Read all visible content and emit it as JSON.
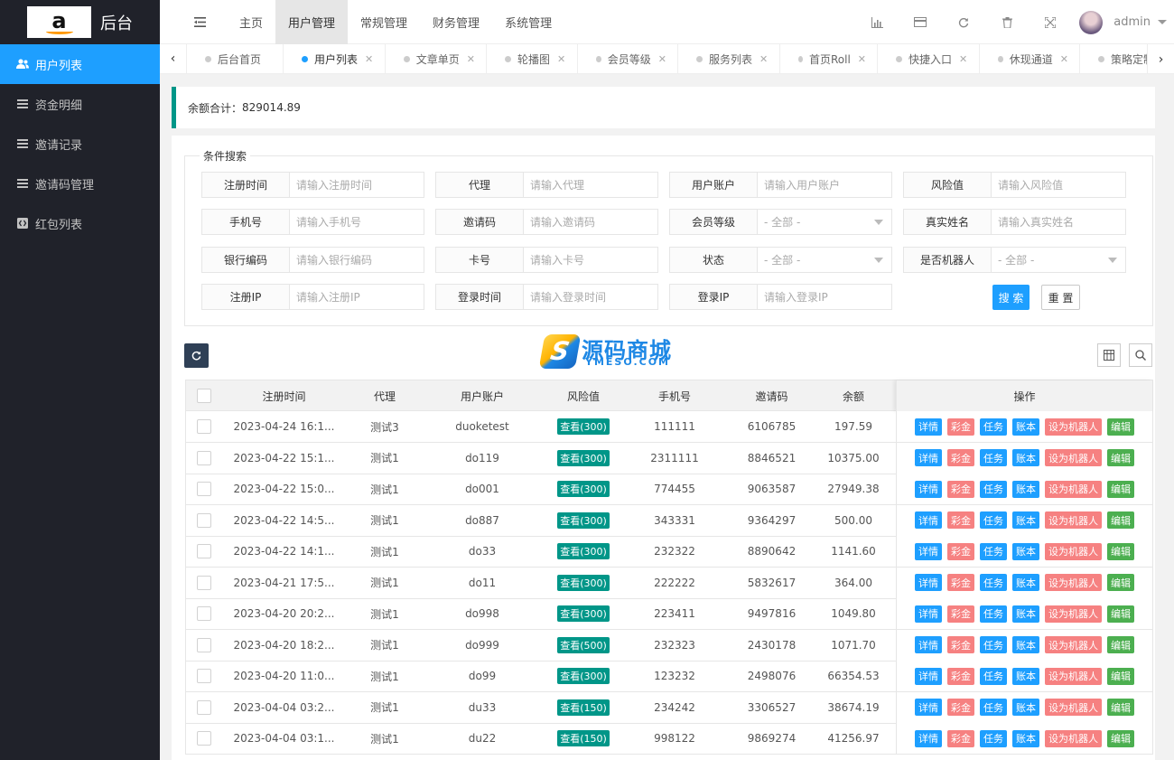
{
  "brand": {
    "logo_letter": "a",
    "title": "后台"
  },
  "sidebar": {
    "items": [
      {
        "label": "用户列表",
        "icon": "users-icon",
        "active": true
      },
      {
        "label": "资金明细",
        "icon": "list-icon",
        "active": false
      },
      {
        "label": "邀请记录",
        "icon": "list-icon",
        "active": false
      },
      {
        "label": "邀请码管理",
        "icon": "list-icon",
        "active": false
      },
      {
        "label": "红包列表",
        "icon": "code-icon",
        "active": false
      }
    ]
  },
  "header": {
    "nav": [
      {
        "label": "主页",
        "active": false
      },
      {
        "label": "用户管理",
        "active": true
      },
      {
        "label": "常规管理",
        "active": false
      },
      {
        "label": "财务管理",
        "active": false
      },
      {
        "label": "系统管理",
        "active": false
      }
    ],
    "user": "admin"
  },
  "tabs": [
    {
      "label": "后台首页",
      "active": false,
      "closable": false
    },
    {
      "label": "用户列表",
      "active": true,
      "closable": true
    },
    {
      "label": "文章单页",
      "active": false,
      "closable": true
    },
    {
      "label": "轮播图",
      "active": false,
      "closable": true
    },
    {
      "label": "会员等级",
      "active": false,
      "closable": true
    },
    {
      "label": "服务列表",
      "active": false,
      "closable": true
    },
    {
      "label": "首页Roll",
      "active": false,
      "closable": true
    },
    {
      "label": "快捷入口",
      "active": false,
      "closable": true
    },
    {
      "label": "休现通道",
      "active": false,
      "closable": true
    },
    {
      "label": "策略定制",
      "active": false,
      "closable": false
    }
  ],
  "summary": {
    "label": "余额合计：",
    "value": "829014.89"
  },
  "search": {
    "legend": "条件搜索",
    "fields": [
      {
        "label": "注册时间",
        "placeholder": "请输入注册时间",
        "select": false
      },
      {
        "label": "代理",
        "placeholder": "请输入代理",
        "select": false
      },
      {
        "label": "用户账户",
        "placeholder": "请输入用户账户",
        "select": false
      },
      {
        "label": "风险值",
        "placeholder": "请输入风险值",
        "select": false
      },
      {
        "label": "手机号",
        "placeholder": "请输入手机号",
        "select": false
      },
      {
        "label": "邀请码",
        "placeholder": "请输入邀请码",
        "select": false
      },
      {
        "label": "会员等级",
        "placeholder": "- 全部 -",
        "select": true
      },
      {
        "label": "真实姓名",
        "placeholder": "请输入真实姓名",
        "select": false
      },
      {
        "label": "银行编码",
        "placeholder": "请输入银行编码",
        "select": false
      },
      {
        "label": "卡号",
        "placeholder": "请输入卡号",
        "select": false
      },
      {
        "label": "状态",
        "placeholder": "- 全部 -",
        "select": true
      },
      {
        "label": "是否机器人",
        "placeholder": "- 全部 -",
        "select": true
      },
      {
        "label": "注册IP",
        "placeholder": "请输入注册IP",
        "select": false
      },
      {
        "label": "登录时间",
        "placeholder": "请输入登录时间",
        "select": false
      },
      {
        "label": "登录IP",
        "placeholder": "请输入登录IP",
        "select": false
      }
    ],
    "search_label": "搜 索",
    "reset_label": "重 置"
  },
  "watermark": {
    "cn": "源码商城",
    "en": "YMESO.COM"
  },
  "table": {
    "columns": [
      "注册时间",
      "代理",
      "用户账户",
      "风险值",
      "手机号",
      "邀请码",
      "余额",
      "操作"
    ],
    "actions": [
      "详情",
      "彩金",
      "任务",
      "账本",
      "设为机器人",
      "编辑"
    ],
    "rows": [
      {
        "time": "2023-04-24 16:1...",
        "agent": "测试3",
        "account": "duoketest",
        "risk": "查看(300)",
        "phone": "111111",
        "code": "6106785",
        "balance": "197.59"
      },
      {
        "time": "2023-04-22 15:1...",
        "agent": "测试1",
        "account": "do119",
        "risk": "查看(300)",
        "phone": "2311111",
        "code": "8846521",
        "balance": "10375.00"
      },
      {
        "time": "2023-04-22 15:0...",
        "agent": "测试1",
        "account": "do001",
        "risk": "查看(300)",
        "phone": "774455",
        "code": "9063587",
        "balance": "27949.38"
      },
      {
        "time": "2023-04-22 14:5...",
        "agent": "测试1",
        "account": "do887",
        "risk": "查看(300)",
        "phone": "343331",
        "code": "9364297",
        "balance": "500.00"
      },
      {
        "time": "2023-04-22 14:1...",
        "agent": "测试1",
        "account": "do33",
        "risk": "查看(300)",
        "phone": "232322",
        "code": "8890642",
        "balance": "1141.60"
      },
      {
        "time": "2023-04-21 17:5...",
        "agent": "测试1",
        "account": "do11",
        "risk": "查看(300)",
        "phone": "222222",
        "code": "5832617",
        "balance": "364.00"
      },
      {
        "time": "2023-04-20 20:2...",
        "agent": "测试1",
        "account": "do998",
        "risk": "查看(300)",
        "phone": "223411",
        "code": "9497816",
        "balance": "1049.80"
      },
      {
        "time": "2023-04-20 18:2...",
        "agent": "测试1",
        "account": "do999",
        "risk": "查看(500)",
        "phone": "232323",
        "code": "2430178",
        "balance": "1071.70"
      },
      {
        "time": "2023-04-20 11:0...",
        "agent": "测试1",
        "account": "do99",
        "risk": "查看(300)",
        "phone": "123232",
        "code": "2498076",
        "balance": "66354.53"
      },
      {
        "time": "2023-04-04 03:2...",
        "agent": "测试1",
        "account": "du33",
        "risk": "查看(150)",
        "phone": "234242",
        "code": "3306527",
        "balance": "38674.19"
      },
      {
        "time": "2023-04-04 03:1...",
        "agent": "测试1",
        "account": "du22",
        "risk": "查看(150)",
        "phone": "998122",
        "code": "9869274",
        "balance": "41256.97"
      }
    ]
  }
}
